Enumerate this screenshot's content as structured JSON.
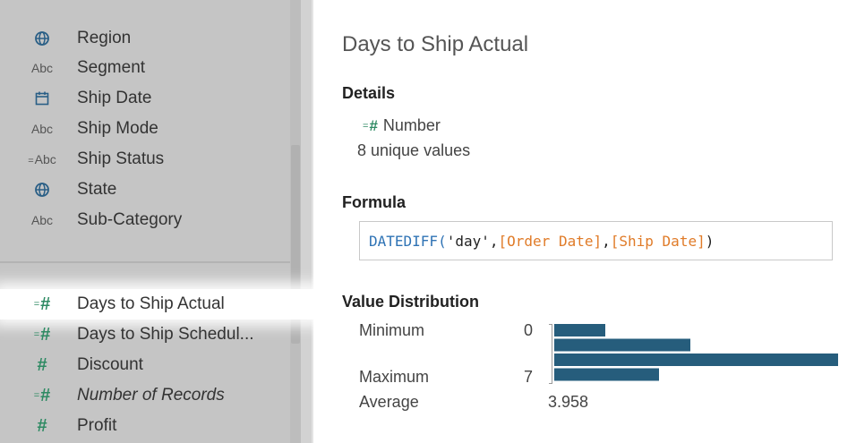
{
  "fields": {
    "dimensions": [
      {
        "icon": "globe-icon",
        "label": "Region"
      },
      {
        "icon": "abc-icon",
        "label": "Segment"
      },
      {
        "icon": "calendar-icon",
        "label": "Ship Date"
      },
      {
        "icon": "abc-icon",
        "label": "Ship Mode"
      },
      {
        "icon": "calc-abc-icon",
        "label": "Ship Status"
      },
      {
        "icon": "globe-icon",
        "label": "State"
      },
      {
        "icon": "abc-icon",
        "label": "Sub-Category"
      }
    ],
    "measures": [
      {
        "icon": "calc-number-icon",
        "label": "Days to Ship Actual",
        "selected": true
      },
      {
        "icon": "calc-number-icon",
        "label": "Days to Ship Schedul..."
      },
      {
        "icon": "number-icon",
        "label": "Discount"
      },
      {
        "icon": "calc-number-icon",
        "label": "Number of Records",
        "italic": true
      },
      {
        "icon": "number-icon",
        "label": "Profit"
      }
    ]
  },
  "icon_text": {
    "abc": "Abc",
    "calc_abc": "Abc",
    "hash": "#",
    "calc_prefix": "="
  },
  "details": {
    "title": "Days to Ship Actual",
    "details_heading": "Details",
    "type_label": "Number",
    "unique_values": "8 unique values",
    "formula_heading": "Formula",
    "formula": {
      "func": "DATEDIFF(",
      "arg1": "'day'",
      "comma1": ",",
      "field1": "[Order Date]",
      "comma2": ",",
      "field2": "[Ship Date]",
      "close": ")"
    },
    "value_distribution_heading": "Value Distribution",
    "minimum_label": "Minimum",
    "minimum_value": "0",
    "maximum_label": "Maximum",
    "maximum_value": "7",
    "average_label": "Average",
    "average_value": "3.958",
    "distribution_bars": [
      0.18,
      0.48,
      1.0,
      0.37
    ]
  },
  "colors": {
    "accent_green": "#2e8a63",
    "bar_color": "#265d7c",
    "formula_function": "#2f73b5",
    "formula_field": "#e07b28"
  }
}
